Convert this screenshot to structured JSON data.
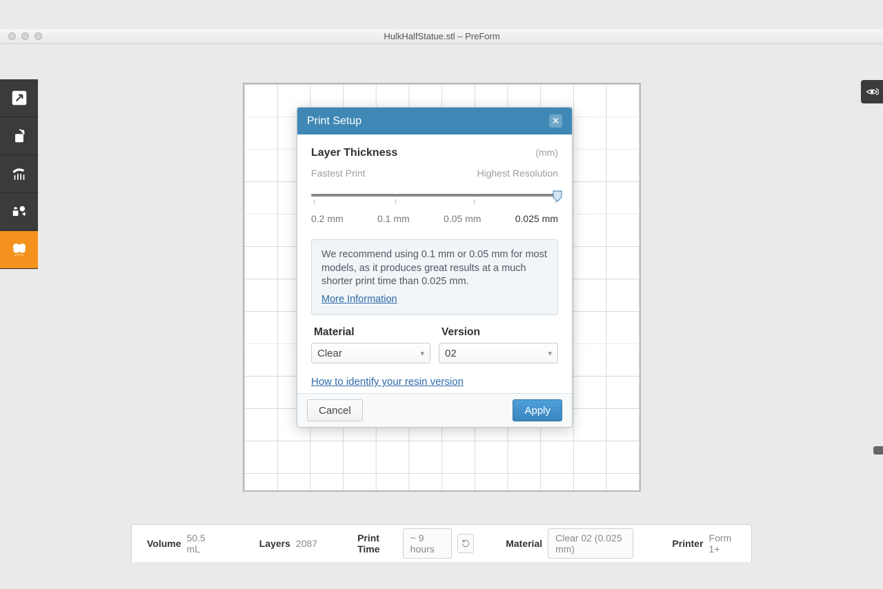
{
  "window": {
    "title": "HulkHalfStatue.stl – PreForm"
  },
  "dialog": {
    "title": "Print Setup",
    "layer_thickness_label": "Layer Thickness",
    "unit": "(mm)",
    "fastest_label": "Fastest Print",
    "highest_label": "Highest Resolution",
    "ticks": {
      "t0": "0.2 mm",
      "t1": "0.1 mm",
      "t2": "0.05 mm",
      "t3": "0.025 mm"
    },
    "selected_tick_index": 3,
    "recommendation": "We recommend using 0.1 mm or 0.05 mm for most models, as it produces great results at a much shorter print time than 0.025 mm.",
    "more_info": "More Information",
    "material_label": "Material",
    "material_value": "Clear",
    "version_label": "Version",
    "version_value": "02",
    "resin_link": "How to identify your resin version",
    "cancel": "Cancel",
    "apply": "Apply"
  },
  "status": {
    "volume_label": "Volume",
    "volume_value": "50.5 mL",
    "layers_label": "Layers",
    "layers_value": "2087",
    "print_time_label": "Print Time",
    "print_time_value": "~ 9 hours",
    "material_label": "Material",
    "material_value": "Clear 02 (0.025 mm)",
    "printer_label": "Printer",
    "printer_value": "Form 1+"
  }
}
